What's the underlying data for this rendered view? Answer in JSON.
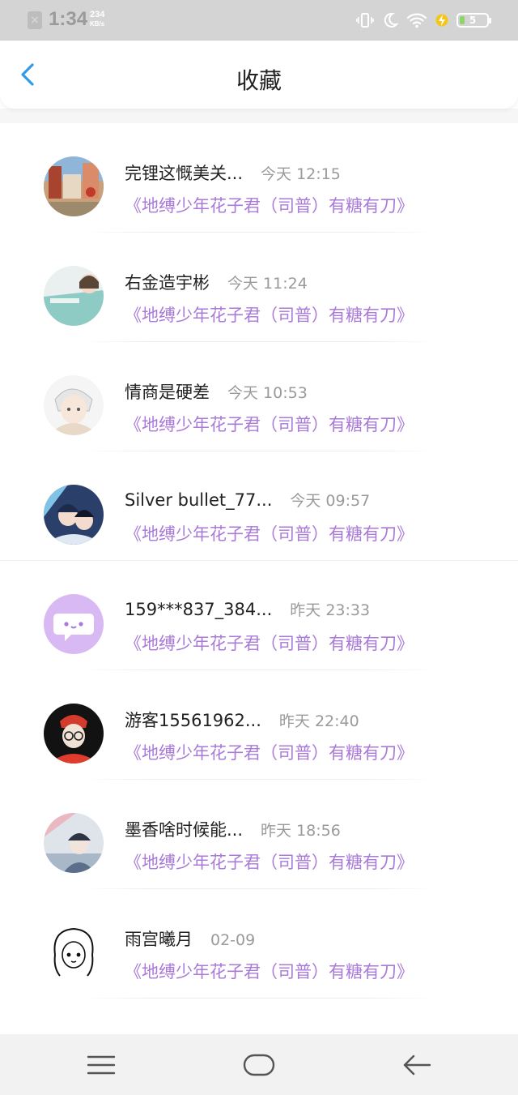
{
  "status_bar": {
    "time": "1:34",
    "speed_value": "234",
    "speed_unit": "KB/s",
    "battery": "5",
    "icons": [
      "sim-off-icon",
      "vibrate-icon",
      "moon-icon",
      "wifi-icon",
      "charging-icon",
      "battery-icon"
    ]
  },
  "header": {
    "back_icon": "chevron-left-icon",
    "title": "收藏"
  },
  "favorites": [
    {
      "name": "完锂这慨美关...",
      "time": "今天 12:15",
      "title": "《地缚少年花子君（司普）有糖有刀》",
      "avatar": "street-scene"
    },
    {
      "name": "右金造宇彬",
      "time": "今天 11:24",
      "title": "《地缚少年花子君（司普）有糖有刀》",
      "avatar": "teal-drawing"
    },
    {
      "name": "情商是硬差",
      "time": "今天 10:53",
      "title": "《地缚少年花子君（司普）有糖有刀》",
      "avatar": "white-hair-boy"
    },
    {
      "name": "Silver bullet_77...",
      "time": "今天 09:57",
      "title": "《地缚少年花子君（司普）有糖有刀》",
      "avatar": "blue-anime"
    },
    {
      "name": "159***837_384...",
      "time": "昨天 23:33",
      "title": "《地缚少年花子君（司普）有糖有刀》",
      "avatar": "default-chat-bubble"
    },
    {
      "name": "游客15561962...",
      "time": "昨天 22:40",
      "title": "《地缚少年花子君（司普）有糖有刀》",
      "avatar": "dark-anime"
    },
    {
      "name": "墨香啥时候能...",
      "time": "昨天 18:56",
      "title": "《地缚少年花子君（司普）有糖有刀》",
      "avatar": "winter-anime"
    },
    {
      "name": "雨宫曦月",
      "time": "02-09",
      "title": "《地缚少年花子君（司普）有糖有刀》",
      "avatar": "sketch-girl"
    }
  ],
  "nav_bar": {
    "icons": [
      "menu-icon",
      "home-icon",
      "back-arrow-icon"
    ]
  },
  "colors": {
    "accent": "#2f9be9",
    "book_title": "#a97ad8",
    "status_bar_bg": "#d4d4d4"
  }
}
